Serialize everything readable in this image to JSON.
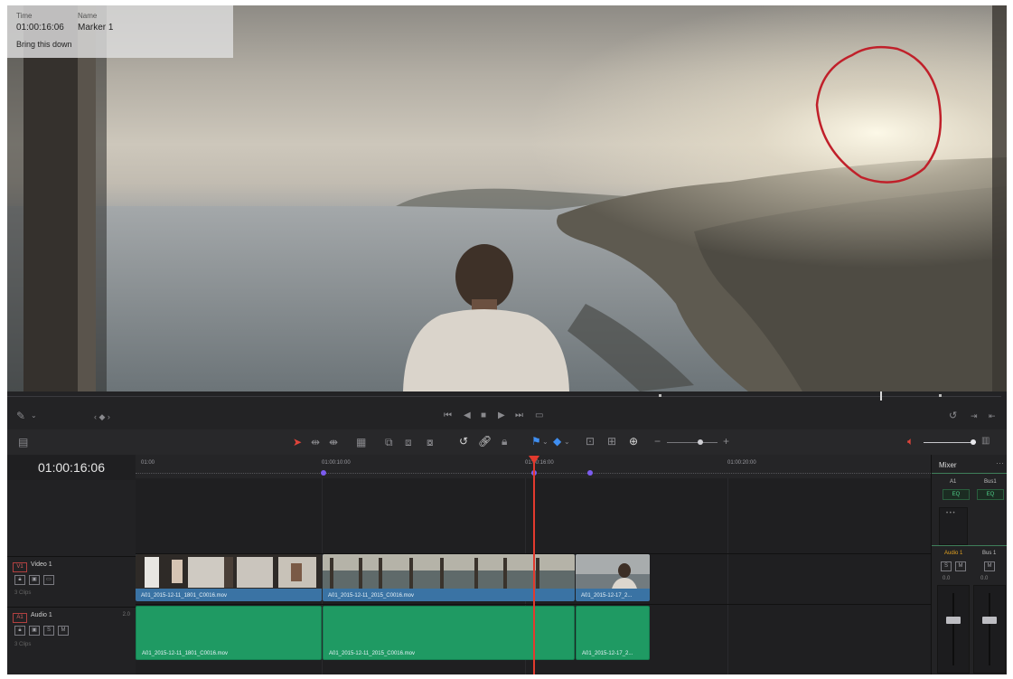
{
  "marker_overlay": {
    "time_label": "Time",
    "time_value": "01:00:16:06",
    "name_label": "Name",
    "name_value": "Marker 1",
    "note": "Bring this down"
  },
  "timeline": {
    "timecode": "01:00:16:06",
    "ruler_labels": [
      "01:00",
      "01:00:10:00",
      "01:00:16:00",
      "01:00:20:00"
    ]
  },
  "tracks": {
    "video": {
      "badge": "V1",
      "name": "Video 1",
      "sub": "3 Clips"
    },
    "audio": {
      "badge": "A1",
      "name": "Audio 1",
      "level": "2.0",
      "sub": "3 Clips"
    }
  },
  "clips": {
    "video": [
      {
        "name": "A01_2015-12-11_1801_C0016.mov"
      },
      {
        "name": "A01_2015-12-11_2015_C0016.mov"
      },
      {
        "name": "A01_2015-12-17_2..."
      }
    ],
    "audio": [
      {
        "name": "A01_2015-12-11_1801_C0016.mov"
      },
      {
        "name": "A01_2015-12-11_2015_C0016.mov"
      },
      {
        "name": "A01_2015-12-17_2..."
      }
    ]
  },
  "mixer": {
    "title": "Mixer",
    "col1": "A1",
    "col2": "Bus1",
    "eq1": "EQ",
    "eq2": "EQ",
    "strip1_label": "Audio 1",
    "strip2_label": "Bus 1",
    "strip1_db": "0.0",
    "strip2_db": "0.0"
  },
  "colors": {
    "playhead": "#e23a2e",
    "video_clip": "#3a73a4",
    "audio_clip": "#1f9a63",
    "marker": "#7c5cf0",
    "annotation": "#c0202a"
  }
}
